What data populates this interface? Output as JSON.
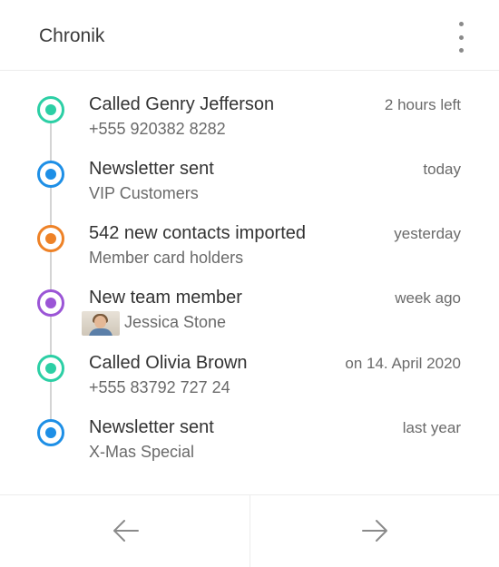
{
  "header": {
    "title": "Chronik",
    "menu_icon": "more-vertical-icon"
  },
  "timeline": [
    {
      "title": "Called Genry Jefferson",
      "subtitle": "+555 920382 8282",
      "time": "2 hours left",
      "color": "#2ccfa5"
    },
    {
      "title": "Newsletter sent",
      "subtitle": "VIP Customers",
      "time": "today",
      "color": "#1e8fe6"
    },
    {
      "title": "542 new contacts imported",
      "subtitle": "Member card holders",
      "time": "yesterday",
      "color": "#ee8227"
    },
    {
      "title": "New team member",
      "subtitle": "Jessica Stone",
      "time": "week ago",
      "color": "#9b55d6",
      "avatar": "avatar-photo"
    },
    {
      "title": "Called Olivia Brown",
      "subtitle": "+555 83792 727 24",
      "time": "on 14. April 2020",
      "color": "#2ccfa5"
    },
    {
      "title": "Newsletter sent",
      "subtitle": "X-Mas Special",
      "time": "last year",
      "color": "#1e8fe6"
    }
  ],
  "footer": {
    "prev_icon": "arrow-left-icon",
    "next_icon": "arrow-right-icon"
  }
}
